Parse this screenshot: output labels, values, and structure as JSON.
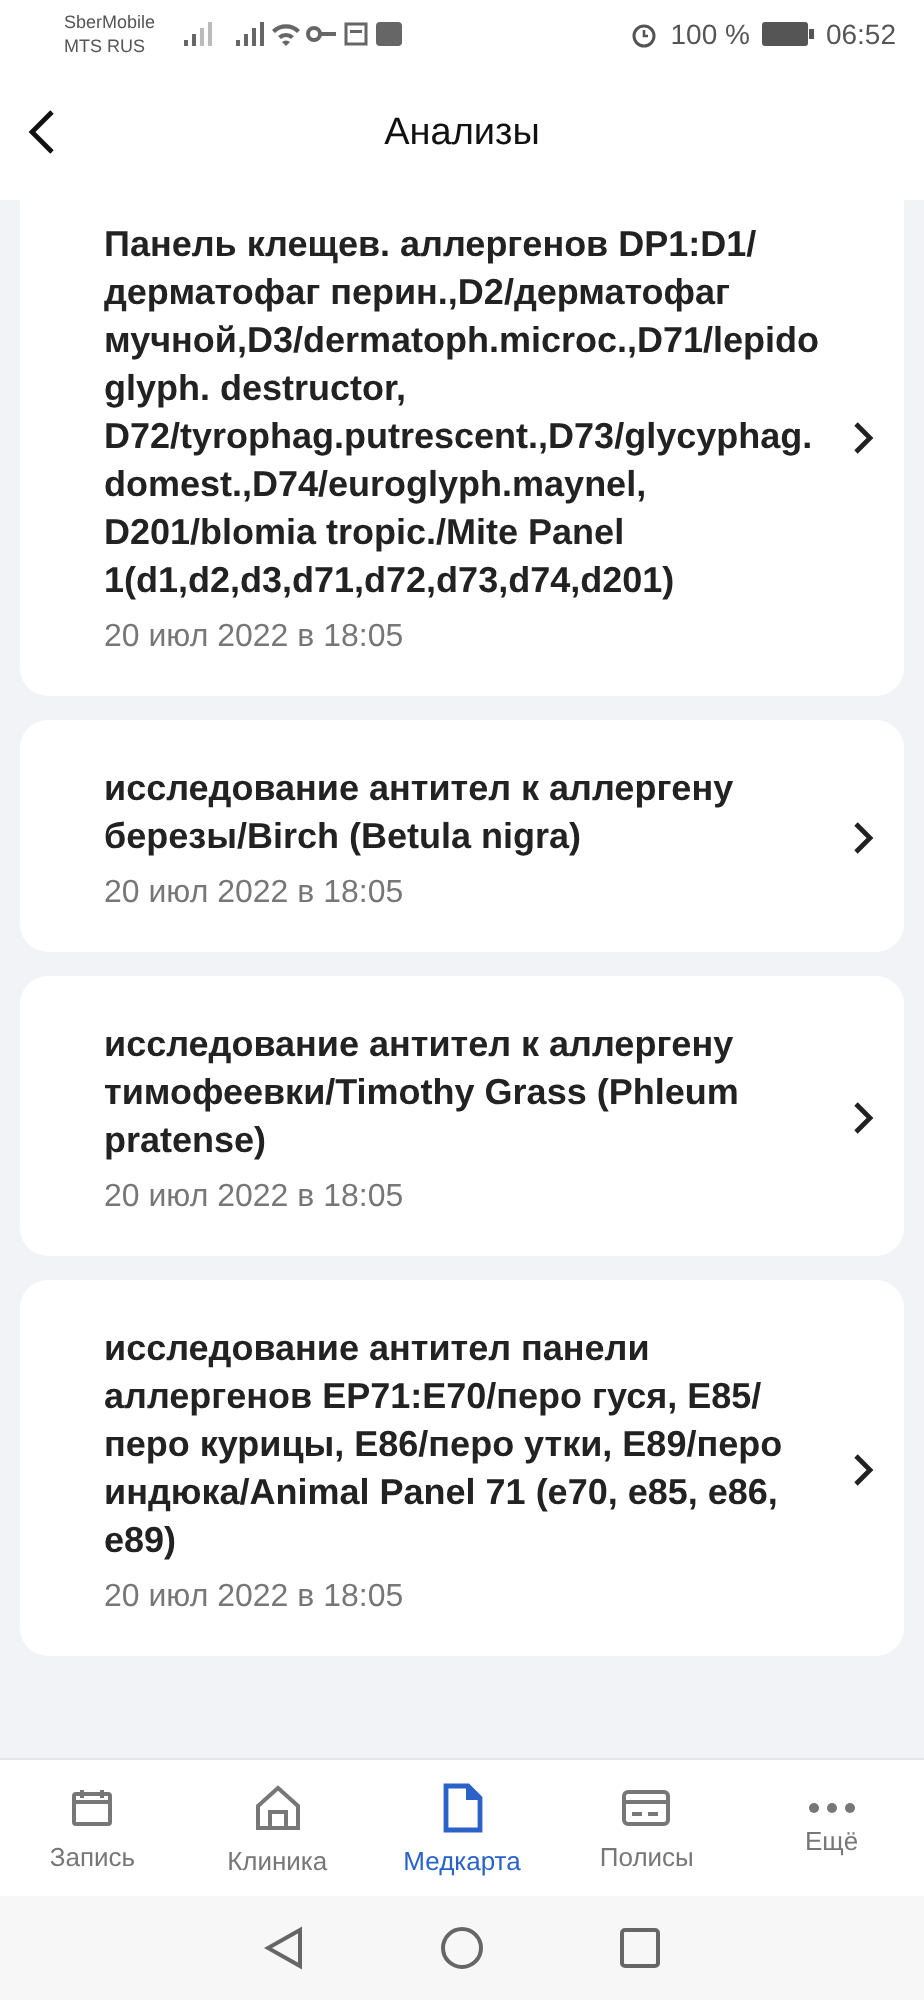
{
  "status_bar": {
    "carrier_1": "SberMobile",
    "carrier_2": "MTS RUS",
    "battery": "100 %",
    "time": "06:52"
  },
  "header": {
    "title": "Анализы"
  },
  "results": [
    {
      "title": "Панель клещев. аллергенов DP1:D1/дерматофаг перин.,D2/дерматофаг мучной,D3/dermatoph.microc.,D71/lepidoglyph. destructor, D72/tyrophag.putrescent.,D73/glycyphag.domest.,D74/euroglyph.maynel, D201/blomia tropic./Mite Panel 1(d1,d2,d3,d71,d72,d73,d74,d201)",
      "date": "20 июл 2022 в 18:05"
    },
    {
      "title": "исследование антител к аллергену березы/Birch (Betula nigra)",
      "date": "20 июл 2022 в 18:05"
    },
    {
      "title": "исследование антител к аллергену тимофеевки/Timothy Grass (Phleum pratense)",
      "date": "20 июл 2022 в 18:05"
    },
    {
      "title": "исследование антител панели аллергенов EP71:E70/перо гуся, E85/перо курицы, E86/перо утки, E89/перо индюка/Animal Panel 71 (e70, e85, e86, e89)",
      "date": "20 июл 2022 в 18:05"
    }
  ],
  "tab_bar": [
    {
      "kind": "calendar",
      "label": "Запись",
      "selected": false
    },
    {
      "kind": "home",
      "label": "Клиника",
      "selected": false
    },
    {
      "kind": "document",
      "label": "Медкарта",
      "selected": true
    },
    {
      "kind": "card",
      "label": "Полисы",
      "selected": false
    },
    {
      "kind": "more",
      "label": "Ещё",
      "selected": false
    }
  ]
}
